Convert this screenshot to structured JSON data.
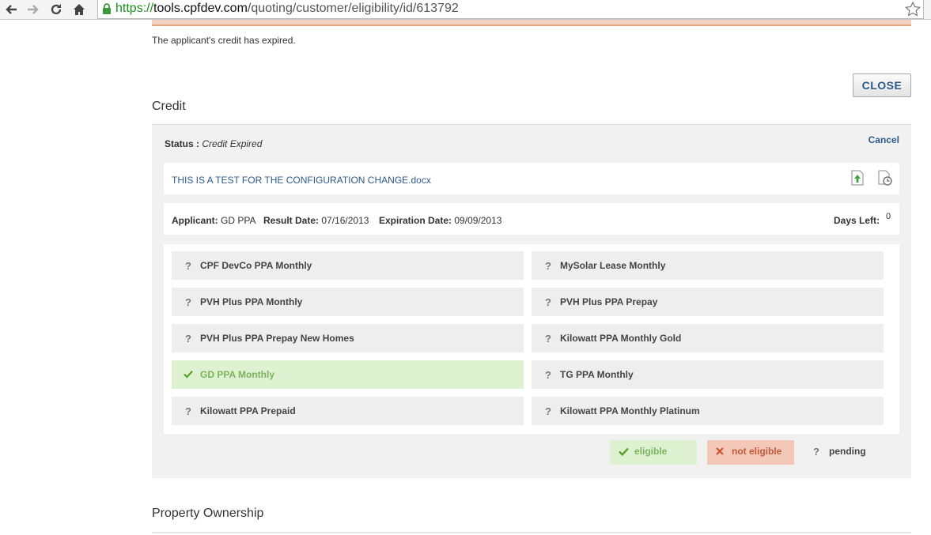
{
  "browser": {
    "url_scheme": "https://",
    "url_host": "tools.cpfdev.com",
    "url_path": "/quoting/customer/eligibility/id/613792"
  },
  "alert": {
    "message": "The applicant's credit has expired."
  },
  "close_label": "CLOSE",
  "credit": {
    "title": "Credit",
    "status_label": "Status :",
    "status_value": "Credit Expired",
    "cancel_label": "Cancel",
    "document_name": "THIS IS A TEST FOR THE CONFIGURATION CHANGE.docx",
    "applicant_label": "Applicant:",
    "applicant_value": "GD PPA",
    "result_date_label": "Result Date:",
    "result_date_value": "07/16/2013",
    "expiration_date_label": "Expiration Date:",
    "expiration_date_value": "09/09/2013",
    "days_left_label": "Days Left:",
    "days_left_value": "0"
  },
  "programs": [
    {
      "label": "CPF DevCo PPA Monthly",
      "status": "pending"
    },
    {
      "label": "MySolar Lease Monthly",
      "status": "pending"
    },
    {
      "label": "PVH Plus PPA Monthly",
      "status": "pending"
    },
    {
      "label": "PVH Plus PPA Prepay",
      "status": "pending"
    },
    {
      "label": "PVH Plus PPA Prepay New Homes",
      "status": "pending"
    },
    {
      "label": "Kilowatt PPA Monthly Gold",
      "status": "pending"
    },
    {
      "label": "GD PPA Monthly",
      "status": "eligible"
    },
    {
      "label": "TG PPA Monthly",
      "status": "pending"
    },
    {
      "label": "Kilowatt PPA Prepaid",
      "status": "pending"
    },
    {
      "label": "Kilowatt PPA Monthly Platinum",
      "status": "pending"
    }
  ],
  "legend": {
    "eligible": "eligible",
    "not_eligible": "not eligible",
    "pending": "pending"
  },
  "property_section_title": "Property Ownership",
  "colors": {
    "link": "#2b5a8a",
    "eligible_bg": "#def2d2",
    "not_eligible_bg": "#f4c8b8",
    "alert_border": "#e8a07f"
  },
  "icons": {
    "back": "arrow-left-icon",
    "forward": "arrow-right-icon",
    "reload": "reload-icon",
    "home": "home-icon",
    "secure": "lock-icon",
    "bookmark": "star-icon",
    "upload": "upload-icon",
    "history": "history-icon",
    "eligible": "check-icon",
    "not_eligible": "x-icon",
    "pending": "question-icon"
  }
}
